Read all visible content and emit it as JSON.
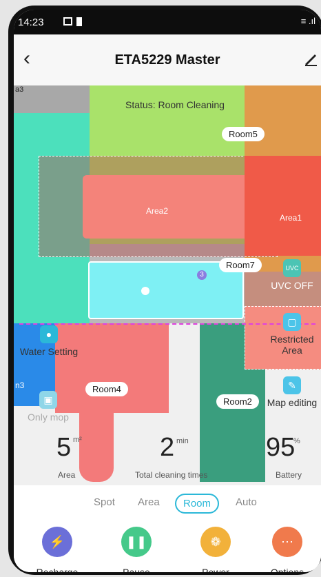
{
  "status_bar": {
    "time": "14:23",
    "signal": "≡ .ıl"
  },
  "header": {
    "title": "ETA5229 Master",
    "back_icon": "‹"
  },
  "map": {
    "status": "Status: Room Cleaning",
    "rooms": {
      "room5": "Room5",
      "room7": "Room7",
      "room4": "Room4",
      "room2": "Room2",
      "edge_left_top": "a3",
      "edge_left_mid": "n3"
    },
    "areas": {
      "area1": "Area1",
      "area2": "Area2"
    },
    "marker_num": "3"
  },
  "side_buttons": {
    "water": "Water Setting",
    "only_mop": "Only mop",
    "uvc": "UVC OFF",
    "uvc_icon": "UVC",
    "restricted": "Restricted Area",
    "map_editing": "Map editing"
  },
  "stats": {
    "area_value": "5",
    "area_unit": "m²",
    "area_label": "Area",
    "times_value": "2",
    "times_unit": "min",
    "times_label": "Total cleaning times",
    "battery_value": "95",
    "battery_unit": "%",
    "battery_label": "Battery"
  },
  "modes": [
    "Spot",
    "Area",
    "Room",
    "Auto"
  ],
  "active_mode": "Room",
  "actions": [
    "Recharge",
    "Pause",
    "Power",
    "Options"
  ],
  "colors": {
    "accent": "#2bb8d8",
    "recharge": "#6b6fd8",
    "pause": "#45c98a",
    "power": "#f2b13a",
    "options": "#f07a4c"
  }
}
